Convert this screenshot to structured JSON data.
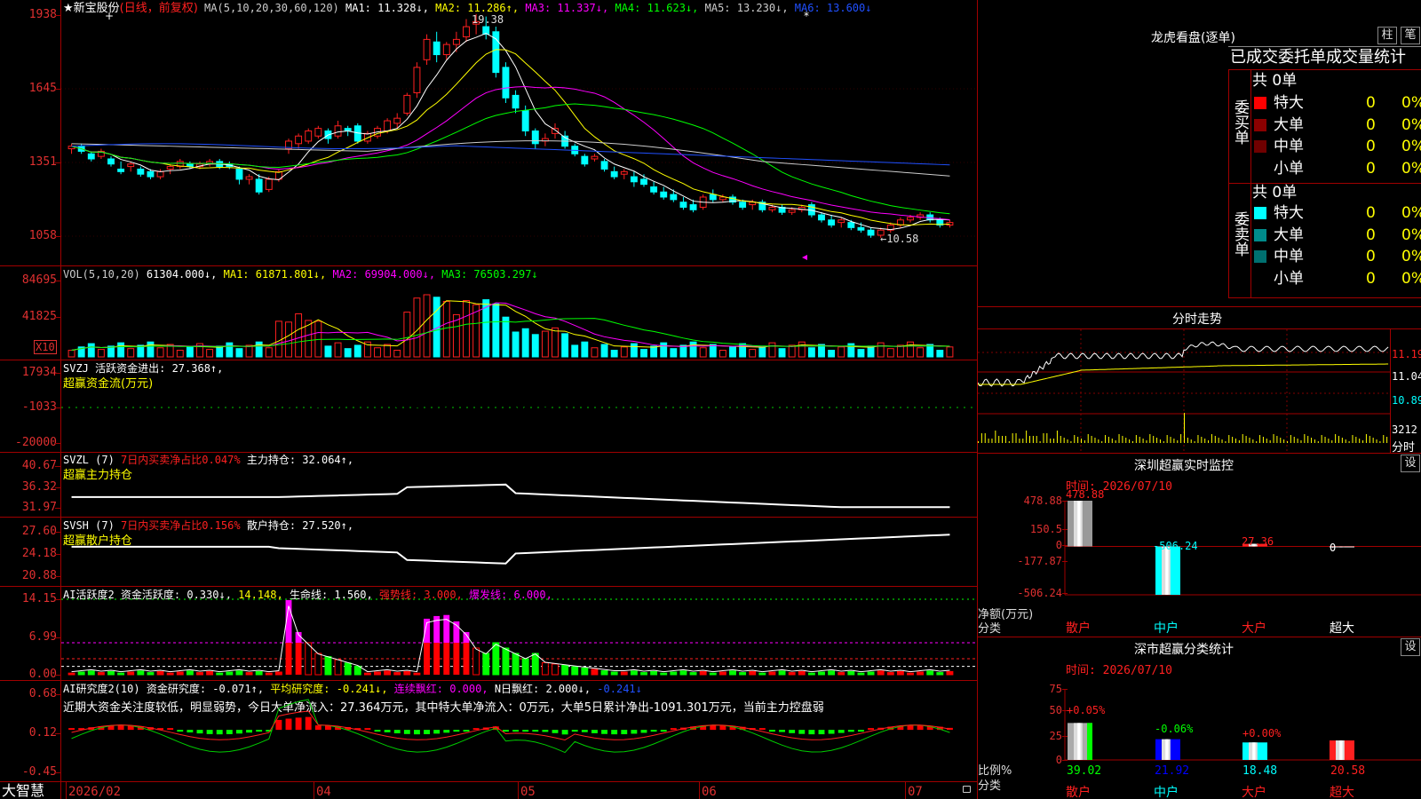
{
  "colors": {
    "up": "#ff2020",
    "down": "#00ffff",
    "frame": "#a00000",
    "axis": "#e03030"
  },
  "main": {
    "title": "★新宝股份",
    "mode": "(日线，前复权)",
    "ma_header": [
      {
        "t": "MA(5,10,20,30,60,120)",
        "c": "#cccccc"
      },
      {
        "t": "MA1: 11.328↓,",
        "c": "#ffffff"
      },
      {
        "t": "MA2: 11.286↑,",
        "c": "#ffff00"
      },
      {
        "t": "MA3: 11.337↓,",
        "c": "#ff00ff"
      },
      {
        "t": "MA4: 11.623↓,",
        "c": "#00ff00"
      },
      {
        "t": "MA5: 13.230↓,",
        "c": "#cccccc"
      },
      {
        "t": "MA6: 13.600↓",
        "c": "#2050ff"
      }
    ],
    "y_labels": [
      "1938",
      "1645",
      "1351",
      "1058"
    ],
    "high_label": "19.38",
    "low_label": "←10.58",
    "candles": [
      [
        14.1,
        14.3,
        13.9,
        14.2
      ],
      [
        14.2,
        14.3,
        13.9,
        14.0
      ],
      [
        13.9,
        14.0,
        13.6,
        13.7
      ],
      [
        13.8,
        14.1,
        13.7,
        14.0
      ],
      [
        13.7,
        13.8,
        13.4,
        13.5
      ],
      [
        13.3,
        13.6,
        13.1,
        13.2
      ],
      [
        13.4,
        13.6,
        13.2,
        13.5
      ],
      [
        13.3,
        13.4,
        13.0,
        13.1
      ],
      [
        13.2,
        13.3,
        12.9,
        13.0
      ],
      [
        13.0,
        13.3,
        12.9,
        13.2
      ],
      [
        13.3,
        13.5,
        13.1,
        13.4
      ],
      [
        13.4,
        13.7,
        13.3,
        13.6
      ],
      [
        13.5,
        13.6,
        13.3,
        13.4
      ],
      [
        13.4,
        13.6,
        13.3,
        13.5
      ],
      [
        13.5,
        13.7,
        13.4,
        13.6
      ],
      [
        13.6,
        13.7,
        13.3,
        13.4
      ],
      [
        13.5,
        13.6,
        13.3,
        13.4
      ],
      [
        13.3,
        13.4,
        12.7,
        12.9
      ],
      [
        12.9,
        13.1,
        12.7,
        13.0
      ],
      [
        12.9,
        13.1,
        12.3,
        12.4
      ],
      [
        12.5,
        13.0,
        12.4,
        12.9
      ],
      [
        12.9,
        13.3,
        12.8,
        13.2
      ],
      [
        14.1,
        14.5,
        13.9,
        14.4
      ],
      [
        14.3,
        14.7,
        14.1,
        14.6
      ],
      [
        14.4,
        14.9,
        14.3,
        14.8
      ],
      [
        14.6,
        15.0,
        14.5,
        14.9
      ],
      [
        14.8,
        14.9,
        14.3,
        14.5
      ],
      [
        14.6,
        15.2,
        14.5,
        15.0
      ],
      [
        14.9,
        15.0,
        14.6,
        14.8
      ],
      [
        15.0,
        15.1,
        14.3,
        14.4
      ],
      [
        14.4,
        14.8,
        14.3,
        14.7
      ],
      [
        14.6,
        15.0,
        14.5,
        14.9
      ],
      [
        14.8,
        15.3,
        14.7,
        15.2
      ],
      [
        15.1,
        15.5,
        14.9,
        15.3
      ],
      [
        15.5,
        16.3,
        15.4,
        16.2
      ],
      [
        16.3,
        17.5,
        16.1,
        17.3
      ],
      [
        17.6,
        18.6,
        17.4,
        18.4
      ],
      [
        18.3,
        18.7,
        17.5,
        17.8
      ],
      [
        17.8,
        18.3,
        17.6,
        18.2
      ],
      [
        18.2,
        18.7,
        17.9,
        18.4
      ],
      [
        18.5,
        19.2,
        18.3,
        18.9
      ],
      [
        19.0,
        19.4,
        18.6,
        19.1
      ],
      [
        18.9,
        19.3,
        18.4,
        18.6
      ],
      [
        18.7,
        18.9,
        16.9,
        17.1
      ],
      [
        17.3,
        17.5,
        15.9,
        16.1
      ],
      [
        16.2,
        16.4,
        15.5,
        15.7
      ],
      [
        15.6,
        15.8,
        14.6,
        14.8
      ],
      [
        14.8,
        14.9,
        14.1,
        14.3
      ],
      [
        14.4,
        14.7,
        14.2,
        14.5
      ],
      [
        14.7,
        15.1,
        14.5,
        14.9
      ],
      [
        14.6,
        14.8,
        14.1,
        14.2
      ],
      [
        14.2,
        14.3,
        13.8,
        13.9
      ],
      [
        13.8,
        13.9,
        13.4,
        13.5
      ],
      [
        13.7,
        13.9,
        13.6,
        13.8
      ],
      [
        13.6,
        13.7,
        13.2,
        13.3
      ],
      [
        13.2,
        13.4,
        12.9,
        13.0
      ],
      [
        13.1,
        13.3,
        12.9,
        13.2
      ],
      [
        13.0,
        13.2,
        12.6,
        12.8
      ],
      [
        12.9,
        13.1,
        12.6,
        12.7
      ],
      [
        12.6,
        12.8,
        12.3,
        12.4
      ],
      [
        12.4,
        12.6,
        12.1,
        12.2
      ],
      [
        12.3,
        12.5,
        12.0,
        12.1
      ],
      [
        12.0,
        12.2,
        11.7,
        11.8
      ],
      [
        11.9,
        12.1,
        11.6,
        11.7
      ],
      [
        11.8,
        12.3,
        11.7,
        12.2
      ],
      [
        12.3,
        12.5,
        12.0,
        12.1
      ],
      [
        12.1,
        12.3,
        12.0,
        12.2
      ],
      [
        12.2,
        12.3,
        11.9,
        12.0
      ],
      [
        12.0,
        12.1,
        11.7,
        11.8
      ],
      [
        11.9,
        12.1,
        11.7,
        12.0
      ],
      [
        12.0,
        12.1,
        11.6,
        11.7
      ],
      [
        11.7,
        11.9,
        11.6,
        11.8
      ],
      [
        11.8,
        11.9,
        11.5,
        11.6
      ],
      [
        11.6,
        11.8,
        11.5,
        11.7
      ],
      [
        11.7,
        11.9,
        11.6,
        11.8
      ],
      [
        11.9,
        12.0,
        11.4,
        11.5
      ],
      [
        11.5,
        11.6,
        11.2,
        11.3
      ],
      [
        11.3,
        11.5,
        11.0,
        11.1
      ],
      [
        11.2,
        11.4,
        11.0,
        11.3
      ],
      [
        11.2,
        11.3,
        10.9,
        11.0
      ],
      [
        11.0,
        11.2,
        10.8,
        10.9
      ],
      [
        10.9,
        11.0,
        10.6,
        10.7
      ],
      [
        10.7,
        11.0,
        10.6,
        10.9
      ],
      [
        10.9,
        11.2,
        10.8,
        11.1
      ],
      [
        11.1,
        11.4,
        11.0,
        11.3
      ],
      [
        11.3,
        11.5,
        11.2,
        11.4
      ],
      [
        11.4,
        11.6,
        11.3,
        11.5
      ],
      [
        11.5,
        11.6,
        11.2,
        11.3
      ],
      [
        11.3,
        11.4,
        11.0,
        11.1
      ],
      [
        11.1,
        11.3,
        11.0,
        11.2
      ]
    ]
  },
  "vol": {
    "header": [
      {
        "t": "VOL(5,10,20)",
        "c": "#cccccc"
      },
      {
        "t": "61304.000↓,",
        "c": "#ffffff"
      },
      {
        "t": "MA1: 61871.801↓,",
        "c": "#ffff00"
      },
      {
        "t": "MA2: 69904.000↓,",
        "c": "#ff00ff"
      },
      {
        "t": "MA3: 76503.297↓",
        "c": "#00ff00"
      }
    ],
    "y_labels": [
      "84695",
      "41825"
    ],
    "unit": "X10"
  },
  "svzj": {
    "header": [
      {
        "t": "SVZJ  活跃资金进出: 27.368↑,",
        "c": "#ffffff"
      }
    ],
    "sub": "超赢资金流(万元)",
    "y_labels": [
      "17934",
      "-1033",
      "-20000"
    ]
  },
  "svzl": {
    "header": [
      {
        "t": "SVZL (7)",
        "c": "#ffffff"
      },
      {
        "t": "7日内买卖净占比0.047%",
        "c": "#ff2020"
      },
      {
        "t": "主力持仓: 32.064↑,",
        "c": "#ffffff"
      }
    ],
    "sub": "超赢主力持仓",
    "y_labels": [
      "40.67",
      "36.32",
      "31.97"
    ]
  },
  "svsh": {
    "header": [
      {
        "t": "SVSH (7)",
        "c": "#ffffff"
      },
      {
        "t": "7日内买卖净占比0.156%",
        "c": "#ff2020"
      },
      {
        "t": "散户持仓: 27.520↑,",
        "c": "#ffffff"
      }
    ],
    "sub": "超赢散户持仓",
    "y_labels": [
      "27.60",
      "24.18",
      "20.88"
    ]
  },
  "aihy": {
    "header": [
      {
        "t": "AI活跃度2",
        "c": "#ffffff"
      },
      {
        "t": "资金活跃度: 0.330↓,",
        "c": "#ffffff"
      },
      {
        "t": "14.148,",
        "c": "#ffff00"
      },
      {
        "t": "生命线: 1.560,",
        "c": "#ffffff"
      },
      {
        "t": "强势线: 3.000,",
        "c": "#ff2020"
      },
      {
        "t": "爆发线: 6.000,",
        "c": "#ff00ff"
      }
    ],
    "y_labels": [
      "14.15",
      "6.99",
      "0.00"
    ]
  },
  "aiyj": {
    "header": [
      {
        "t": "AI研究度2(10)",
        "c": "#ffffff"
      },
      {
        "t": "资金研究度: -0.071↑,",
        "c": "#ffffff"
      },
      {
        "t": "平均研究度: -0.241↓,",
        "c": "#ffff00"
      },
      {
        "t": "连续飘红: 0.000,",
        "c": "#ff00ff"
      },
      {
        "t": "N日飘红: 2.000↓,",
        "c": "#ffffff"
      },
      {
        "t": "-0.241↓",
        "c": "#2050ff"
      }
    ],
    "comment": "近期大资金关注度较低，明显弱势，今日大单净流入：27.364万元，其中特大单净流入：0万元，大单5日累计净出-1091.301万元，当前主力控盘弱",
    "y_labels": [
      "0.68",
      "0.12",
      "-0.45"
    ]
  },
  "bottom": {
    "brand": "大智慧",
    "dates": [
      "2026/02",
      "04",
      "05",
      "06",
      "07"
    ]
  },
  "right": {
    "lhb_title": "龙虎看盘(逐单)",
    "btn1": "柱",
    "btn2": "笔",
    "tabs": "已成交委托单成交量统计",
    "buy_label": "委买单",
    "sell_label": "委卖单",
    "buy_total": "共 0单",
    "sell_total": "共 0单",
    "buy_rows": [
      {
        "n": "特大",
        "v": "0",
        "p": "0%",
        "c": "#ff0000"
      },
      {
        "n": "大单",
        "v": "0",
        "p": "0%",
        "c": "#8b0000"
      },
      {
        "n": "中单",
        "v": "0",
        "p": "0%",
        "c": "#700000"
      },
      {
        "n": "小单",
        "v": "0",
        "p": "0%",
        "c": ""
      }
    ],
    "sell_rows": [
      {
        "n": "特大",
        "v": "0",
        "p": "0%",
        "c": "#00ffff"
      },
      {
        "n": "大单",
        "v": "0",
        "p": "0%",
        "c": "#008b8b"
      },
      {
        "n": "中单",
        "v": "0",
        "p": "0%",
        "c": "#007070"
      },
      {
        "n": "小单",
        "v": "0",
        "p": "0%",
        "c": ""
      }
    ],
    "fs_title": "分时走势",
    "fs_y": [
      "11.19",
      "11.04",
      "10.89"
    ],
    "fs_vol": "3212",
    "fs_vol_unit": "分时",
    "sz_title": "深圳超赢实时监控",
    "sz_btn": "设",
    "sz_time": "时间: 2026/07/10",
    "sz_y": [
      "478.88",
      "150.5",
      "0",
      "-177.87",
      "-506.24"
    ],
    "sz_vals": [
      {
        "t": "478.88",
        "c": "#ff2020"
      },
      {
        "t": "-506.24",
        "c": "#00ffff"
      },
      {
        "t": "27.36",
        "c": "#ff2020"
      },
      {
        "t": "0",
        "c": "#ffffff"
      }
    ],
    "sz_unit1": "净额(万元)",
    "sz_unit2": "分类",
    "cats": [
      "散户",
      "中户",
      "大户",
      "超大"
    ],
    "fl_title": "深市超赢分类统计",
    "fl_btn": "设",
    "fl_time": "时间: 2026/07/10",
    "fl_y": [
      "75",
      "50",
      "25",
      "0"
    ],
    "fl_pct": [
      {
        "t": "+0.05%",
        "c": "#ff2020"
      },
      {
        "t": "-0.06%",
        "c": "#00ff00"
      },
      {
        "t": "+0.00%",
        "c": "#ff2020"
      },
      {
        "t": "",
        "c": "#ff2020"
      }
    ],
    "fl_vals": [
      "39.02",
      "21.92",
      "18.48",
      "20.58"
    ],
    "fl_unit1": "比例%",
    "fl_unit2": "分类"
  }
}
